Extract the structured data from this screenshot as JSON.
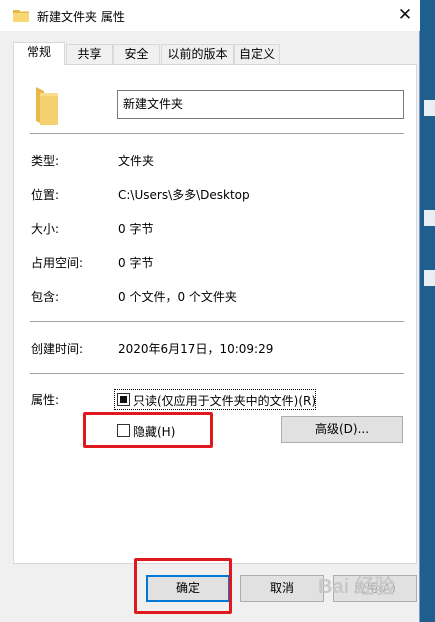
{
  "window": {
    "title": "新建文件夹 属性",
    "close_glyph": "✕"
  },
  "tabs": [
    "常规",
    "共享",
    "安全",
    "以前的版本",
    "自定义"
  ],
  "folder_name": "新建文件夹",
  "rows": {
    "type": {
      "label": "类型:",
      "value": "文件夹"
    },
    "location": {
      "label": "位置:",
      "value": "C:\\Users\\多多\\Desktop"
    },
    "size": {
      "label": "大小:",
      "value": "0 字节"
    },
    "disk_size": {
      "label": "占用空间:",
      "value": "0 字节"
    },
    "contains": {
      "label": "包含:",
      "value": "0 个文件，0 个文件夹"
    },
    "created": {
      "label": "创建时间:",
      "value": "2020年6月17日，10:09:29"
    }
  },
  "attributes": {
    "label": "属性:",
    "readonly_label": "只读(仅应用于文件夹中的文件)(R)",
    "hidden_label": "隐藏(H)",
    "advanced_label": "高级(D)..."
  },
  "buttons": {
    "ok": "确定",
    "cancel": "取消",
    "apply": "应用(A)"
  },
  "watermark": "Bai 经验",
  "colors": {
    "highlight_box": "#e0191f",
    "focus_blue": "#0078d7"
  }
}
